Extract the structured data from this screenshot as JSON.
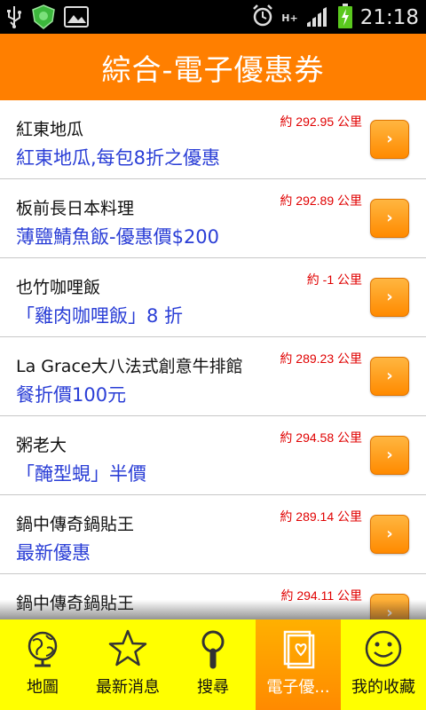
{
  "status": {
    "time": "21:18",
    "network": "H+"
  },
  "header": {
    "title": "綜合-電子優惠券"
  },
  "coupons": [
    {
      "store": "紅東地瓜",
      "offer": "紅東地瓜,每包8折之優惠",
      "distance": "約 292.95 公里"
    },
    {
      "store": "板前長日本料理",
      "offer": "薄鹽鯖魚飯-優惠價$200",
      "distance": "約 292.89 公里"
    },
    {
      "store": "也竹咖哩飯",
      "offer": "「雞肉咖哩飯」8 折",
      "distance": "約 -1 公里"
    },
    {
      "store": "La Grace大八法式創意牛排館",
      "offer": "餐折價100元",
      "distance": "約 289.23 公里"
    },
    {
      "store": "粥老大",
      "offer": "「醃型蜆」半價",
      "distance": "約 294.58 公里"
    },
    {
      "store": "鍋中傳奇鍋貼王",
      "offer": "最新優惠",
      "distance": "約 289.14 公里"
    },
    {
      "store": "鍋中傳奇鍋貼王",
      "offer": "",
      "distance": "約 294.11 公里"
    }
  ],
  "tabs": [
    {
      "label": "地圖",
      "icon": "globe-icon"
    },
    {
      "label": "最新消息",
      "icon": "star-icon"
    },
    {
      "label": "搜尋",
      "icon": "magnifier-icon"
    },
    {
      "label": "電子優...",
      "icon": "coupon-icon"
    },
    {
      "label": "我的收藏",
      "icon": "smiley-icon"
    }
  ],
  "colors": {
    "title_bar": "#ff7f00",
    "tab_bar": "#ffff00",
    "offer_text": "#2a3ed6",
    "distance_text": "#e00000"
  }
}
